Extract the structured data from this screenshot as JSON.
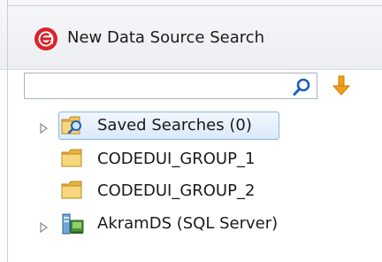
{
  "header": {
    "logo_icon": "e-logo-icon",
    "title": "New Data Source Search"
  },
  "search": {
    "value": "",
    "placeholder": "",
    "search_icon": "magnifier-icon",
    "action_icon": "down-arrow-icon"
  },
  "tree": {
    "nodes": [
      {
        "label": "Saved Searches (0)",
        "icon": "saved-search-folder-icon",
        "expandable": true,
        "selected": true
      },
      {
        "label": "CODEDUI_GROUP_1",
        "icon": "folder-icon",
        "expandable": false,
        "selected": false
      },
      {
        "label": "CODEDUI_GROUP_2",
        "icon": "folder-icon",
        "expandable": false,
        "selected": false
      },
      {
        "label": "AkramDS (SQL Server)",
        "icon": "database-server-icon",
        "expandable": true,
        "selected": false
      }
    ]
  },
  "colors": {
    "logo_red": "#d9232d",
    "folder_yellow": "#f2c45a",
    "arrow_orange": "#f0a21a",
    "selection_border": "#8fb6e0",
    "search_blue": "#1f5fbf"
  }
}
